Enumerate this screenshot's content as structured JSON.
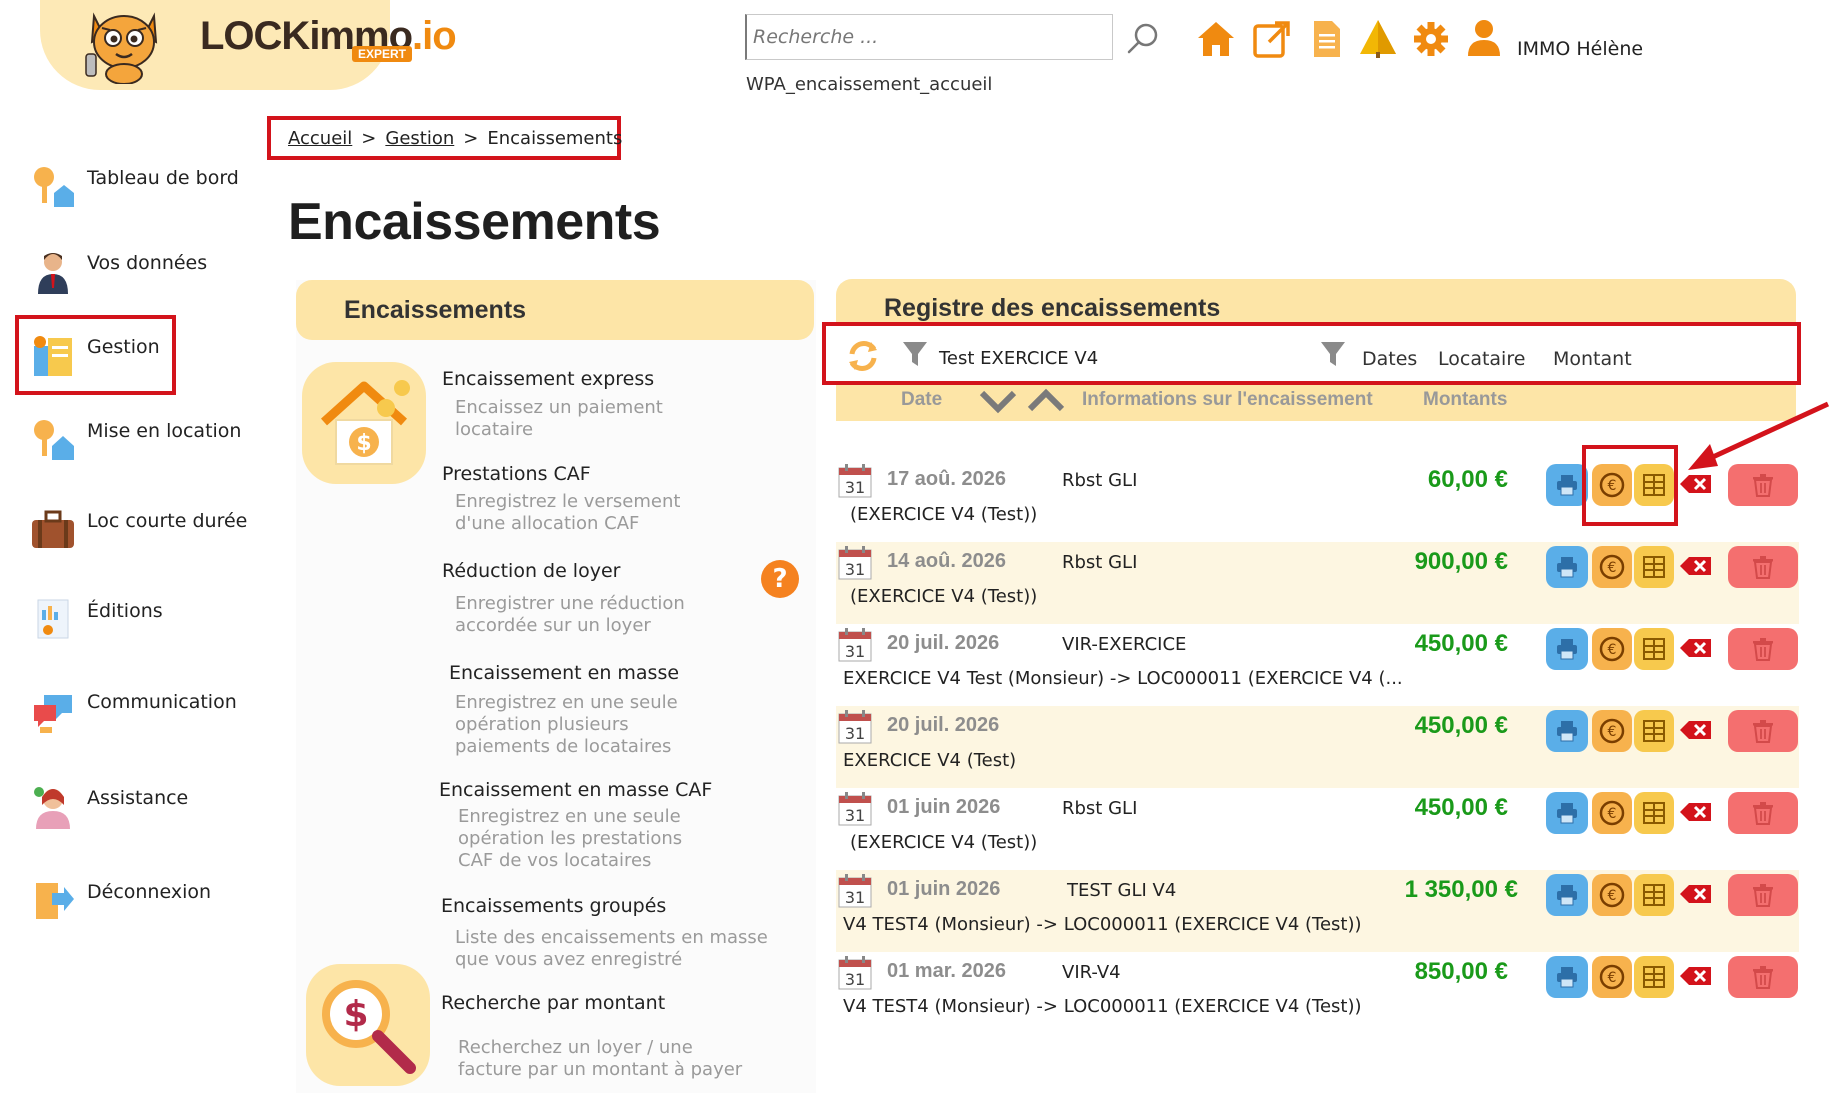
{
  "logo": {
    "brand_main": "LOCKimmo",
    "brand_suffix": ".io",
    "badge": "EXPERT"
  },
  "topbar": {
    "search_placeholder": "Recherche ...",
    "user_name": "IMMO Hélène",
    "page_code": "WPA_encaissement_accueil",
    "icons": [
      "home-icon",
      "external-link-icon",
      "document-icon",
      "tree-icon",
      "gear-icon",
      "user-icon"
    ]
  },
  "breadcrumb": {
    "home": "Accueil",
    "sep1": ">",
    "section": "Gestion",
    "sep2": ">",
    "current": "Encaissements"
  },
  "sidebar": {
    "items": [
      {
        "label": "Tableau de bord",
        "icon": "dashboard-key-icon"
      },
      {
        "label": "Vos données",
        "icon": "person-icon"
      },
      {
        "label": "Gestion",
        "icon": "management-icon",
        "active": true
      },
      {
        "label": "Mise en location",
        "icon": "rental-key-icon"
      },
      {
        "label": "Loc courte durée",
        "icon": "suitcase-icon"
      },
      {
        "label": "Éditions",
        "icon": "report-icon"
      },
      {
        "label": "Communication",
        "icon": "chat-icon"
      },
      {
        "label": "Assistance",
        "icon": "support-agent-icon"
      },
      {
        "label": "Déconnexion",
        "icon": "logout-icon"
      }
    ]
  },
  "page_title": "Encaissements",
  "left_panel": {
    "header": "Encaissements",
    "actions": [
      {
        "title": "Encaissement express",
        "desc": "Encaissez un paiement locataire"
      },
      {
        "title": "Prestations CAF",
        "desc": "Enregistrez le versement d'une allocation CAF"
      },
      {
        "title": "Réduction de loyer",
        "desc": "Enregistrer une réduction accordée sur un loyer"
      },
      {
        "title": "Encaissement en masse",
        "desc": "Enregistrez en une seule opération plusieurs paiements de locataires"
      },
      {
        "title": "Encaissement en masse CAF",
        "desc": "Enregistrez en une seule opération les prestations CAF de vos locataires"
      },
      {
        "title": "Encaissements groupés",
        "desc": "Liste des encaissements en masse que vous avez enregistré"
      },
      {
        "title": "Recherche par montant",
        "desc": "Recherchez un loyer / une facture par un montant à payer"
      }
    ],
    "help_symbol": "?"
  },
  "register": {
    "header": "Registre des encaissements",
    "filter_text": "Test EXERCICE V4",
    "filter_columns": [
      "Dates",
      "Locataire",
      "Montant"
    ],
    "sort_columns": {
      "date": "Date",
      "info": "Informations sur l'encaissement",
      "amounts": "Montants"
    },
    "rows": [
      {
        "day": "31",
        "date": "17 aoû. 2026",
        "ref": "Rbst GLI",
        "info": "(EXERCICE V4 (Test))",
        "amount": "60,00 €"
      },
      {
        "day": "31",
        "date": "14 aoû. 2026",
        "ref": "Rbst GLI",
        "info": "(EXERCICE V4 (Test))",
        "amount": "900,00 €"
      },
      {
        "day": "31",
        "date": "20 juil. 2026",
        "ref": "VIR-EXERCICE",
        "info": "EXERCICE V4 Test (Monsieur) -> LOC000011 (EXERCICE V4 (...",
        "amount": "450,00 €"
      },
      {
        "day": "31",
        "date": "20 juil. 2026",
        "ref": "",
        "info": "EXERCICE V4 (Test)",
        "amount": "450,00 €"
      },
      {
        "day": "31",
        "date": "01 juin 2026",
        "ref": "Rbst GLI",
        "info": "(EXERCICE V4 (Test))",
        "amount": "450,00 €"
      },
      {
        "day": "31",
        "date": "01 juin 2026",
        "ref": "TEST GLI V4",
        "info": "V4 TEST4 (Monsieur) -> LOC000011 (EXERCICE V4 (Test))",
        "amount": "1 350,00 €"
      },
      {
        "day": "31",
        "date": "01 mar. 2026",
        "ref": "VIR-V4",
        "info": "V4 TEST4 (Monsieur) -> LOC000011 (EXERCICE V4 (Test))",
        "amount": "850,00 €"
      }
    ]
  },
  "colors": {
    "accent_orange": "#f08a10",
    "panel_yellow": "#fde5a7",
    "highlight_red": "#d3131b",
    "amount_green": "#1a9a1a",
    "print_blue": "#5aaee8",
    "delete_red": "#f46f6f"
  }
}
